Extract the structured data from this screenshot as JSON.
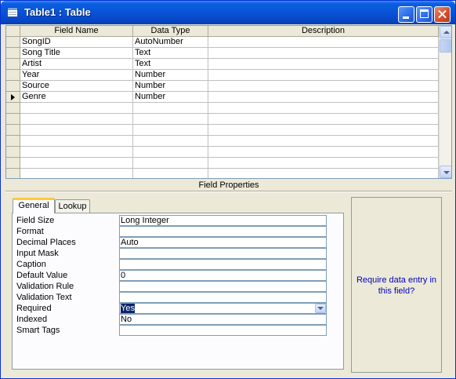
{
  "window": {
    "title": "Table1 : Table"
  },
  "grid": {
    "headers": [
      "Field Name",
      "Data Type",
      "Description"
    ],
    "rows": [
      {
        "field": "SongID",
        "type": "AutoNumber",
        "desc": ""
      },
      {
        "field": "Song Title",
        "type": "Text",
        "desc": ""
      },
      {
        "field": "Artist",
        "type": "Text",
        "desc": ""
      },
      {
        "field": "Year",
        "type": "Number",
        "desc": ""
      },
      {
        "field": "Source",
        "type": "Number",
        "desc": ""
      },
      {
        "field": "Genre",
        "type": "Number",
        "desc": ""
      }
    ],
    "current_row": 5,
    "empty_rows": 7
  },
  "field_properties": {
    "title": "Field Properties",
    "tabs": [
      "General",
      "Lookup"
    ],
    "active_tab": "General",
    "properties": [
      {
        "label": "Field Size",
        "value": "Long Integer"
      },
      {
        "label": "Format",
        "value": ""
      },
      {
        "label": "Decimal Places",
        "value": "Auto"
      },
      {
        "label": "Input Mask",
        "value": ""
      },
      {
        "label": "Caption",
        "value": ""
      },
      {
        "label": "Default Value",
        "value": "0"
      },
      {
        "label": "Validation Rule",
        "value": ""
      },
      {
        "label": "Validation Text",
        "value": ""
      },
      {
        "label": "Required",
        "value": "Yes",
        "dropdown": true,
        "selected": true
      },
      {
        "label": "Indexed",
        "value": "No"
      },
      {
        "label": "Smart Tags",
        "value": ""
      }
    ],
    "help_text": "Require data entry in this field?"
  },
  "colors": {
    "title_bar": "#0a53d6",
    "help_text": "#0000c0",
    "selection": "#0a246a"
  }
}
